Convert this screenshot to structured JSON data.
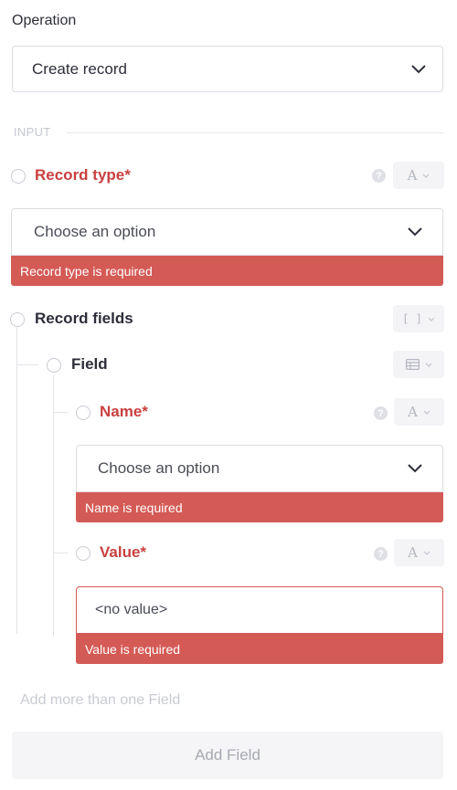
{
  "operation": {
    "label": "Operation",
    "value": "Create record"
  },
  "section": {
    "label": "INPUT"
  },
  "record_type": {
    "label": "Record type*",
    "placeholder": "Choose an option",
    "error": "Record type is required",
    "type_badge": "A"
  },
  "record_fields": {
    "label": "Record fields",
    "type_badge": "[ ]"
  },
  "field": {
    "label": "Field"
  },
  "name": {
    "label": "Name*",
    "placeholder": "Choose an option",
    "error": "Name is required",
    "type_badge": "A"
  },
  "value": {
    "label": "Value*",
    "input_value": "<no value>",
    "error": "Value is required",
    "type_badge": "A"
  },
  "add_more_hint": "Add more than one Field",
  "add_field_button": "Add Field",
  "help_mark": "?"
}
